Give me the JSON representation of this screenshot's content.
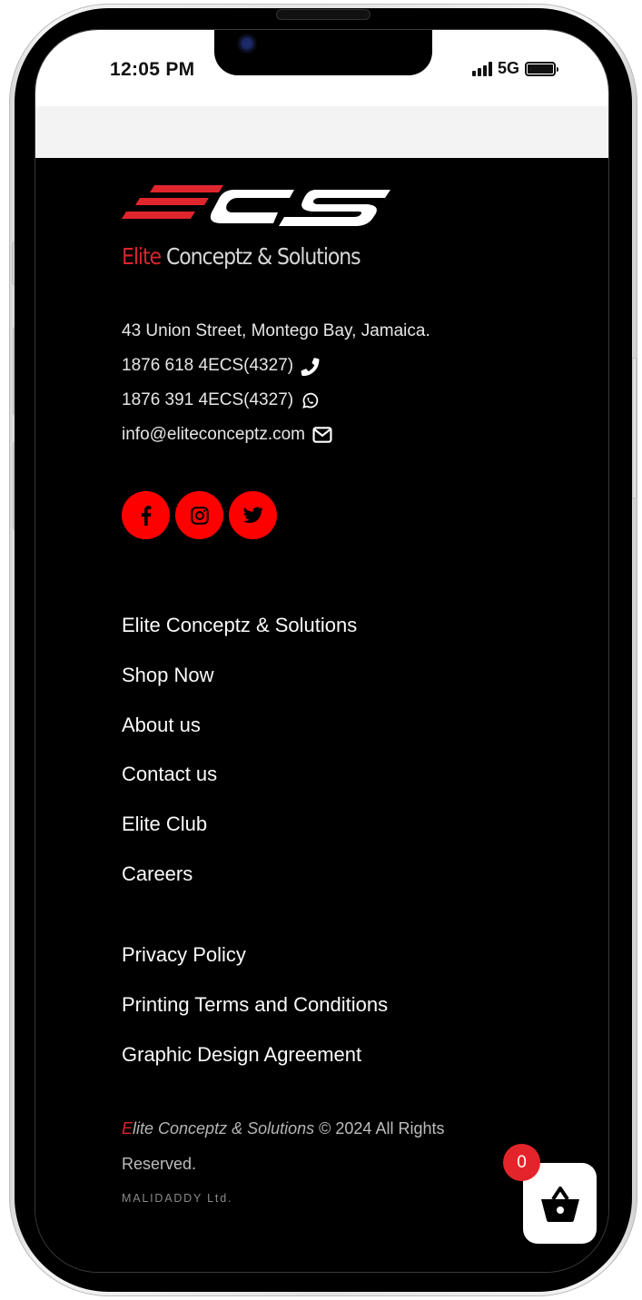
{
  "status_bar": {
    "time": "12:05 PM",
    "network": "5G",
    "signal_bars": 4,
    "battery_percent": 100
  },
  "logo": {
    "mark": "ECS",
    "name_first": "Elite",
    "name_rest": " Conceptz & Solutions",
    "accent_color": "#d9242b"
  },
  "contact": {
    "address": "43 Union Street, Montego Bay, Jamaica.",
    "phone": "1876 618 4ECS(4327)",
    "phone_icon": "phone-icon",
    "whatsapp": "1876 391 4ECS(4327)",
    "whatsapp_icon": "whatsapp-icon",
    "email": "info@eliteconceptz.com",
    "email_icon": "envelope-icon"
  },
  "social": {
    "color": "#ff0000",
    "items": [
      {
        "name": "facebook",
        "icon": "facebook-icon"
      },
      {
        "name": "instagram",
        "icon": "instagram-icon"
      },
      {
        "name": "twitter",
        "icon": "twitter-icon"
      }
    ]
  },
  "menu_primary": [
    "Elite Conceptz & Solutions",
    "Shop Now",
    "About us",
    "Contact us",
    "Elite Club",
    "Careers"
  ],
  "menu_legal": [
    "Privacy Policy",
    "Printing Terms and Conditions",
    "Graphic Design Agreement"
  ],
  "copyright": {
    "brand_initial": "E",
    "brand_rest": "lite Conceptz & Solutions",
    "text": " © 2024 All Rights Reserved."
  },
  "credit": "MALIDADDY Ltd.",
  "cart": {
    "count": "0",
    "icon": "shopping-basket-icon",
    "badge_color": "#e3252b"
  }
}
